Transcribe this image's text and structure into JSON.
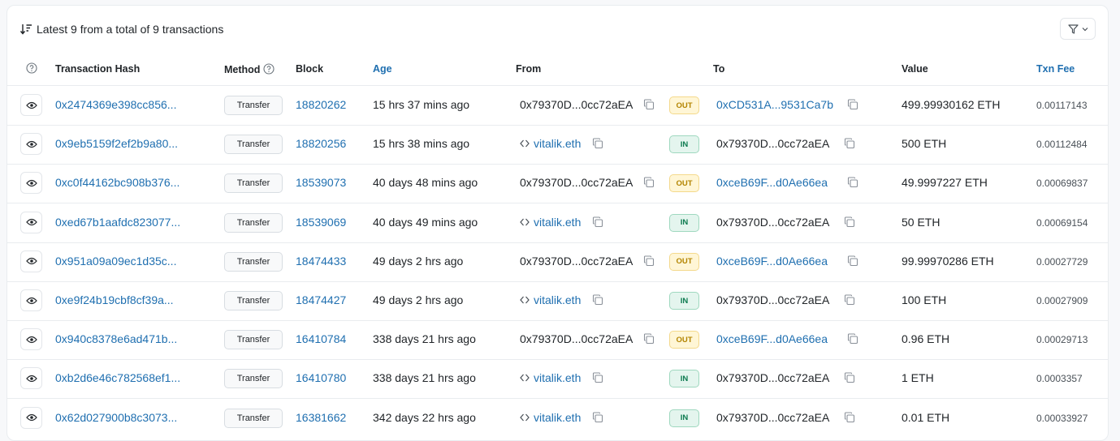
{
  "summary": "Latest 9 from a total of 9 transactions",
  "columns": {
    "hash": "Transaction Hash",
    "method": "Method",
    "block": "Block",
    "age": "Age",
    "from": "From",
    "to": "To",
    "value": "Value",
    "fee": "Txn Fee"
  },
  "rows": [
    {
      "hash": "0x2474369e398cc856...",
      "method": "Transfer",
      "block": "18820262",
      "age": "15 hrs 37 mins ago",
      "from": "0x79370D...0cc72aEA",
      "from_named": false,
      "direction": "OUT",
      "to": "0xCD531A...9531Ca7b",
      "to_link": true,
      "value": "499.99930162 ETH",
      "fee": "0.00117143"
    },
    {
      "hash": "0x9eb5159f2ef2b9a80...",
      "method": "Transfer",
      "block": "18820256",
      "age": "15 hrs 38 mins ago",
      "from": "vitalik.eth",
      "from_named": true,
      "direction": "IN",
      "to": "0x79370D...0cc72aEA",
      "to_link": false,
      "value": "500 ETH",
      "fee": "0.00112484"
    },
    {
      "hash": "0xc0f44162bc908b376...",
      "method": "Transfer",
      "block": "18539073",
      "age": "40 days 48 mins ago",
      "from": "0x79370D...0cc72aEA",
      "from_named": false,
      "direction": "OUT",
      "to": "0xceB69F...d0Ae66ea",
      "to_link": true,
      "value": "49.9997227 ETH",
      "fee": "0.00069837"
    },
    {
      "hash": "0xed67b1aafdc823077...",
      "method": "Transfer",
      "block": "18539069",
      "age": "40 days 49 mins ago",
      "from": "vitalik.eth",
      "from_named": true,
      "direction": "IN",
      "to": "0x79370D...0cc72aEA",
      "to_link": false,
      "value": "50 ETH",
      "fee": "0.00069154"
    },
    {
      "hash": "0x951a09a09ec1d35c...",
      "method": "Transfer",
      "block": "18474433",
      "age": "49 days 2 hrs ago",
      "from": "0x79370D...0cc72aEA",
      "from_named": false,
      "direction": "OUT",
      "to": "0xceB69F...d0Ae66ea",
      "to_link": true,
      "value": "99.99970286 ETH",
      "fee": "0.00027729"
    },
    {
      "hash": "0xe9f24b19cbf8cf39a...",
      "method": "Transfer",
      "block": "18474427",
      "age": "49 days 2 hrs ago",
      "from": "vitalik.eth",
      "from_named": true,
      "direction": "IN",
      "to": "0x79370D...0cc72aEA",
      "to_link": false,
      "value": "100 ETH",
      "fee": "0.00027909"
    },
    {
      "hash": "0x940c8378e6ad471b...",
      "method": "Transfer",
      "block": "16410784",
      "age": "338 days 21 hrs ago",
      "from": "0x79370D...0cc72aEA",
      "from_named": false,
      "direction": "OUT",
      "to": "0xceB69F...d0Ae66ea",
      "to_link": true,
      "value": "0.96 ETH",
      "fee": "0.00029713"
    },
    {
      "hash": "0xb2d6e46c782568ef1...",
      "method": "Transfer",
      "block": "16410780",
      "age": "338 days 21 hrs ago",
      "from": "vitalik.eth",
      "from_named": true,
      "direction": "IN",
      "to": "0x79370D...0cc72aEA",
      "to_link": false,
      "value": "1 ETH",
      "fee": "0.0003357"
    },
    {
      "hash": "0x62d027900b8c3073...",
      "method": "Transfer",
      "block": "16381662",
      "age": "342 days 22 hrs ago",
      "from": "vitalik.eth",
      "from_named": true,
      "direction": "IN",
      "to": "0x79370D...0cc72aEA",
      "to_link": false,
      "value": "0.01 ETH",
      "fee": "0.00033927"
    }
  ],
  "icons": {
    "sort": "sort-descending-icon",
    "filter": "filter-icon",
    "help": "question-circle-icon",
    "eye": "eye-icon",
    "copy": "copy-icon",
    "contract": "contract-code-icon"
  },
  "colors": {
    "link": "#1f6fb0",
    "out_bg": "#fff6d6",
    "out_text": "#b38400",
    "in_bg": "#e4f5ee",
    "in_text": "#0c7a4f"
  }
}
